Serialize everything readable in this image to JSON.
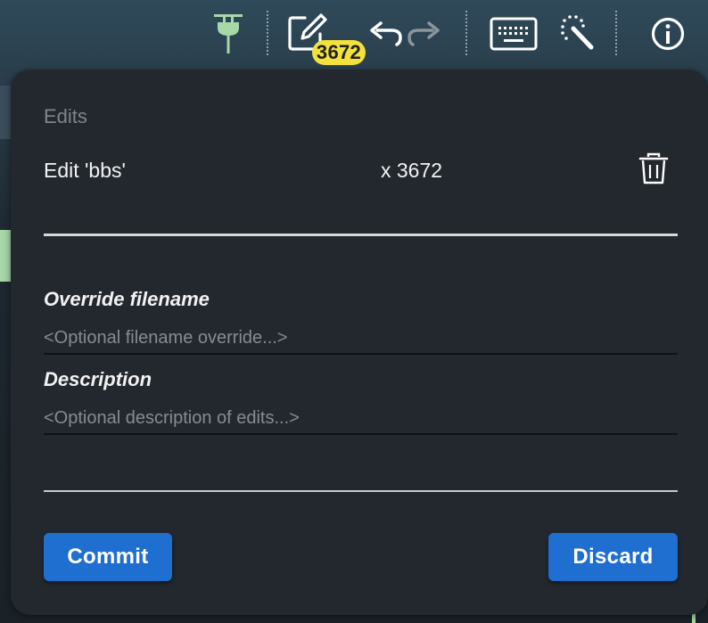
{
  "toolbar": {
    "edit_count_badge": "3672",
    "icons": [
      "plug-icon",
      "edit-icon",
      "undo-icon",
      "redo-icon",
      "keyboard-icon",
      "magic-wand-icon",
      "info-icon"
    ]
  },
  "panel": {
    "title": "Edits",
    "edits": [
      {
        "label": "Edit 'bbs'",
        "count": "x 3672"
      }
    ],
    "override_filename": {
      "label": "Override filename",
      "placeholder": "<Optional filename override...>",
      "value": ""
    },
    "description": {
      "label": "Description",
      "placeholder": "<Optional description of edits...>",
      "value": ""
    },
    "commit_label": "Commit",
    "discard_label": "Discard"
  },
  "colors": {
    "accent": "#1f6fd1",
    "badge": "#f2e23b",
    "plug": "#a6d8a8",
    "panel": "#23282e"
  }
}
